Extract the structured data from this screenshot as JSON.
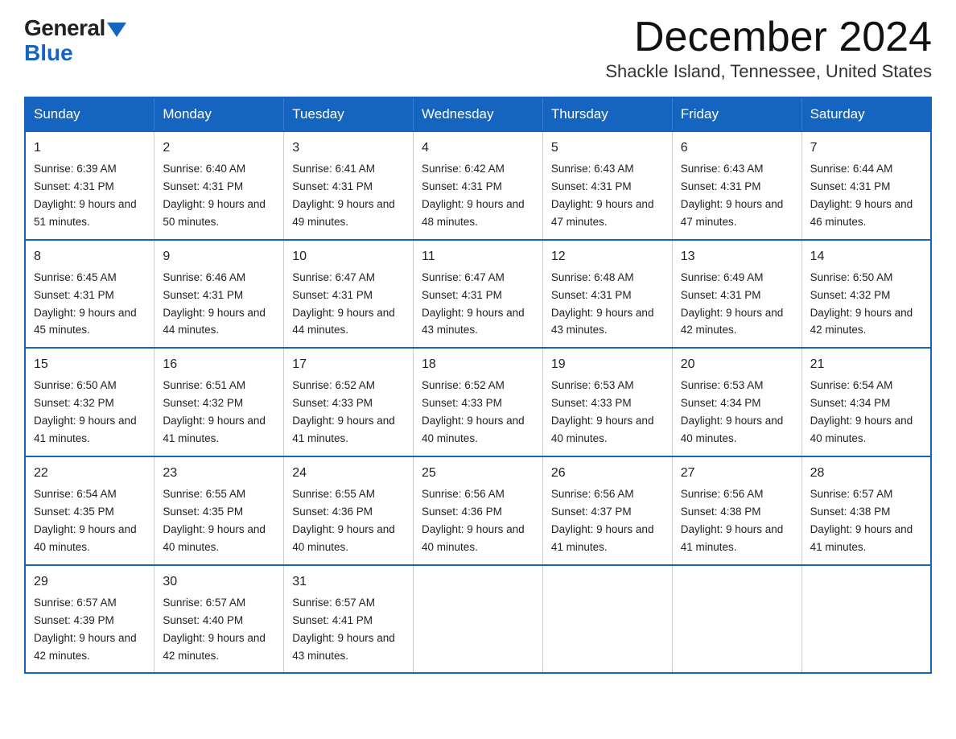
{
  "logo": {
    "general": "General",
    "arrow_color": "#1565c0",
    "blue": "Blue"
  },
  "title": {
    "month_year": "December 2024",
    "location": "Shackle Island, Tennessee, United States"
  },
  "calendar": {
    "days_of_week": [
      "Sunday",
      "Monday",
      "Tuesday",
      "Wednesday",
      "Thursday",
      "Friday",
      "Saturday"
    ],
    "weeks": [
      [
        {
          "day": "1",
          "sunrise": "6:39 AM",
          "sunset": "4:31 PM",
          "daylight": "9 hours and 51 minutes."
        },
        {
          "day": "2",
          "sunrise": "6:40 AM",
          "sunset": "4:31 PM",
          "daylight": "9 hours and 50 minutes."
        },
        {
          "day": "3",
          "sunrise": "6:41 AM",
          "sunset": "4:31 PM",
          "daylight": "9 hours and 49 minutes."
        },
        {
          "day": "4",
          "sunrise": "6:42 AM",
          "sunset": "4:31 PM",
          "daylight": "9 hours and 48 minutes."
        },
        {
          "day": "5",
          "sunrise": "6:43 AM",
          "sunset": "4:31 PM",
          "daylight": "9 hours and 47 minutes."
        },
        {
          "day": "6",
          "sunrise": "6:43 AM",
          "sunset": "4:31 PM",
          "daylight": "9 hours and 47 minutes."
        },
        {
          "day": "7",
          "sunrise": "6:44 AM",
          "sunset": "4:31 PM",
          "daylight": "9 hours and 46 minutes."
        }
      ],
      [
        {
          "day": "8",
          "sunrise": "6:45 AM",
          "sunset": "4:31 PM",
          "daylight": "9 hours and 45 minutes."
        },
        {
          "day": "9",
          "sunrise": "6:46 AM",
          "sunset": "4:31 PM",
          "daylight": "9 hours and 44 minutes."
        },
        {
          "day": "10",
          "sunrise": "6:47 AM",
          "sunset": "4:31 PM",
          "daylight": "9 hours and 44 minutes."
        },
        {
          "day": "11",
          "sunrise": "6:47 AM",
          "sunset": "4:31 PM",
          "daylight": "9 hours and 43 minutes."
        },
        {
          "day": "12",
          "sunrise": "6:48 AM",
          "sunset": "4:31 PM",
          "daylight": "9 hours and 43 minutes."
        },
        {
          "day": "13",
          "sunrise": "6:49 AM",
          "sunset": "4:31 PM",
          "daylight": "9 hours and 42 minutes."
        },
        {
          "day": "14",
          "sunrise": "6:50 AM",
          "sunset": "4:32 PM",
          "daylight": "9 hours and 42 minutes."
        }
      ],
      [
        {
          "day": "15",
          "sunrise": "6:50 AM",
          "sunset": "4:32 PM",
          "daylight": "9 hours and 41 minutes."
        },
        {
          "day": "16",
          "sunrise": "6:51 AM",
          "sunset": "4:32 PM",
          "daylight": "9 hours and 41 minutes."
        },
        {
          "day": "17",
          "sunrise": "6:52 AM",
          "sunset": "4:33 PM",
          "daylight": "9 hours and 41 minutes."
        },
        {
          "day": "18",
          "sunrise": "6:52 AM",
          "sunset": "4:33 PM",
          "daylight": "9 hours and 40 minutes."
        },
        {
          "day": "19",
          "sunrise": "6:53 AM",
          "sunset": "4:33 PM",
          "daylight": "9 hours and 40 minutes."
        },
        {
          "day": "20",
          "sunrise": "6:53 AM",
          "sunset": "4:34 PM",
          "daylight": "9 hours and 40 minutes."
        },
        {
          "day": "21",
          "sunrise": "6:54 AM",
          "sunset": "4:34 PM",
          "daylight": "9 hours and 40 minutes."
        }
      ],
      [
        {
          "day": "22",
          "sunrise": "6:54 AM",
          "sunset": "4:35 PM",
          "daylight": "9 hours and 40 minutes."
        },
        {
          "day": "23",
          "sunrise": "6:55 AM",
          "sunset": "4:35 PM",
          "daylight": "9 hours and 40 minutes."
        },
        {
          "day": "24",
          "sunrise": "6:55 AM",
          "sunset": "4:36 PM",
          "daylight": "9 hours and 40 minutes."
        },
        {
          "day": "25",
          "sunrise": "6:56 AM",
          "sunset": "4:36 PM",
          "daylight": "9 hours and 40 minutes."
        },
        {
          "day": "26",
          "sunrise": "6:56 AM",
          "sunset": "4:37 PM",
          "daylight": "9 hours and 41 minutes."
        },
        {
          "day": "27",
          "sunrise": "6:56 AM",
          "sunset": "4:38 PM",
          "daylight": "9 hours and 41 minutes."
        },
        {
          "day": "28",
          "sunrise": "6:57 AM",
          "sunset": "4:38 PM",
          "daylight": "9 hours and 41 minutes."
        }
      ],
      [
        {
          "day": "29",
          "sunrise": "6:57 AM",
          "sunset": "4:39 PM",
          "daylight": "9 hours and 42 minutes."
        },
        {
          "day": "30",
          "sunrise": "6:57 AM",
          "sunset": "4:40 PM",
          "daylight": "9 hours and 42 minutes."
        },
        {
          "day": "31",
          "sunrise": "6:57 AM",
          "sunset": "4:41 PM",
          "daylight": "9 hours and 43 minutes."
        },
        null,
        null,
        null,
        null
      ]
    ]
  }
}
